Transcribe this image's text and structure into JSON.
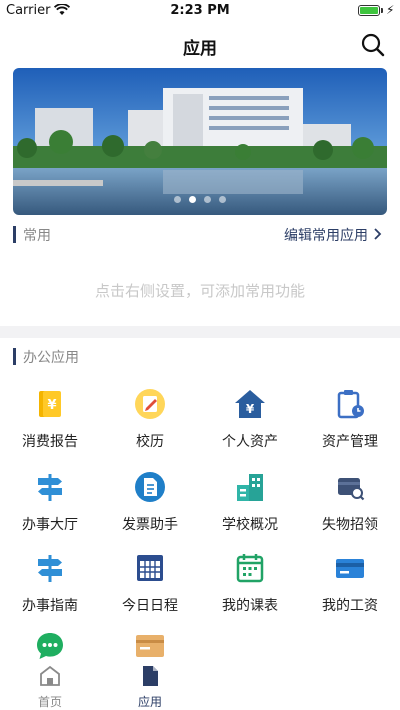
{
  "status_bar": {
    "carrier": "Carrier",
    "time": "2:23 PM"
  },
  "nav": {
    "title": "应用"
  },
  "banner": {
    "dot_count": 4,
    "active_dot": 1
  },
  "favorites": {
    "title": "常用",
    "edit_label": "编辑常用应用",
    "empty_hint": "点击右侧设置，可添加常用功能"
  },
  "office": {
    "title": "办公应用",
    "apps": [
      {
        "label": "消费报告",
        "icon": "consumption-report-icon"
      },
      {
        "label": "校历",
        "icon": "school-calendar-icon"
      },
      {
        "label": "个人资产",
        "icon": "personal-assets-icon"
      },
      {
        "label": "资产管理",
        "icon": "asset-management-icon"
      },
      {
        "label": "办事大厅",
        "icon": "service-hall-icon"
      },
      {
        "label": "发票助手",
        "icon": "invoice-assistant-icon"
      },
      {
        "label": "学校概况",
        "icon": "school-overview-icon"
      },
      {
        "label": "失物招领",
        "icon": "lost-and-found-icon"
      },
      {
        "label": "办事指南",
        "icon": "service-guide-icon"
      },
      {
        "label": "今日日程",
        "icon": "today-schedule-icon"
      },
      {
        "label": "我的课表",
        "icon": "my-timetable-icon"
      },
      {
        "label": "我的工资",
        "icon": "my-salary-icon"
      },
      {
        "label": "",
        "icon": "chat-icon"
      },
      {
        "label": "",
        "icon": "card-icon"
      }
    ]
  },
  "tabs": [
    {
      "label": "首页",
      "icon": "home-icon",
      "active": false
    },
    {
      "label": "应用",
      "icon": "document-icon",
      "active": true
    }
  ],
  "colors": {
    "accent": "#2c3e66",
    "tab_inactive": "#888888",
    "divider": "#f2f2f4"
  }
}
